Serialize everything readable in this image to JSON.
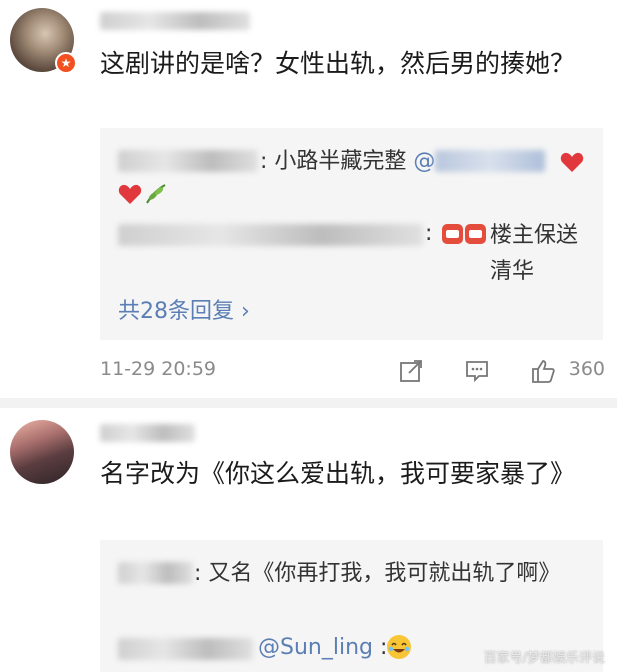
{
  "comments": [
    {
      "text": "这剧讲的是啥？女性出轨，然后男的揍她？",
      "replies": [
        {
          "suffix": ": 小路半藏完整",
          "mention": "@"
        },
        {
          "suffix": ": ",
          "tail": "楼主保送清华"
        }
      ],
      "more_replies": "共28条回复 ›",
      "time": "11-29 20:59",
      "like_count": "360",
      "icons": [
        "share-icon",
        "comment-icon",
        "like-icon"
      ]
    },
    {
      "text": "名字改为《你这么爱出轨，我可要家暴了》",
      "replies": [
        {
          "suffix": ": 又名《你再打我，我可就出轨了啊》"
        },
        {
          "mention": "@Sun_ling",
          "suffix": " :"
        }
      ]
    }
  ],
  "watermark": "百家号/梦都娱乐评说",
  "colors": {
    "link": "#5b7fb5",
    "badge": "#f3501f",
    "heart": "#e0383d"
  }
}
